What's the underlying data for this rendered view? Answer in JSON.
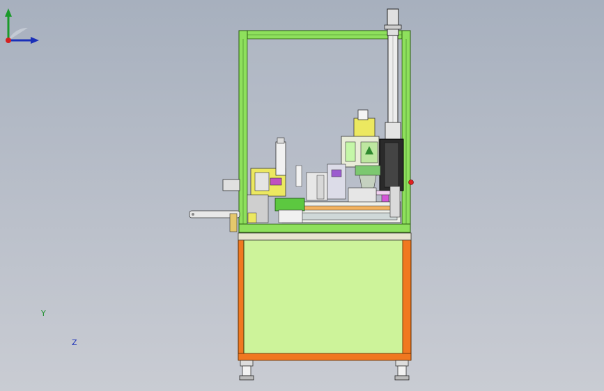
{
  "viewport": {
    "background_top": "#a7b0be",
    "background_bottom": "#c9ccd3"
  },
  "colors": {
    "frame_green": "#8ee05c",
    "base_orange": "#f07820",
    "base_panel": "#cdf39a",
    "mech_pink": "#d455d8",
    "mech_yellow": "#ece860",
    "mech_dark": "#2a2a2a",
    "stop_red": "#e02020"
  },
  "triad": {
    "y_label": "Y",
    "z_label": "Z",
    "icon": "axis-triad-icon"
  }
}
